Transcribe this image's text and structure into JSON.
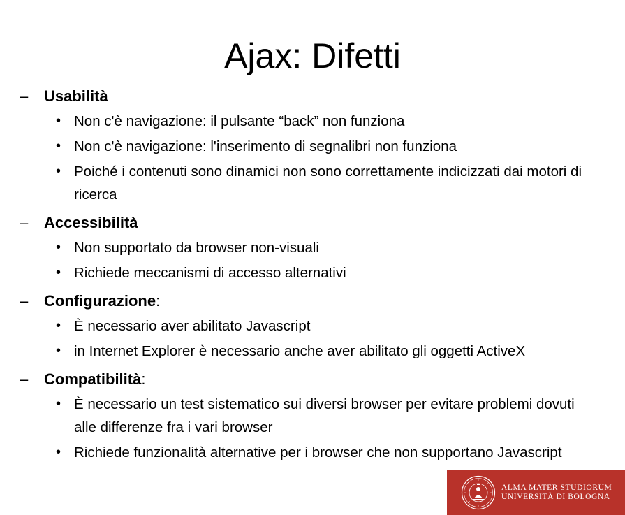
{
  "slide": {
    "title": "Ajax: Difetti"
  },
  "sections": [
    {
      "dash": "–",
      "heading": "Usabilità",
      "suffix": "",
      "items": [
        "Non c'è navigazione: il pulsante “back” non funziona",
        "Non c'è navigazione: l'inserimento di segnalibri non funziona",
        "Poiché i contenuti sono dinamici non sono correttamente indicizzati dai motori di ricerca"
      ]
    },
    {
      "dash": "–",
      "heading": "Accessibilità",
      "suffix": "",
      "items": [
        "Non supportato da browser non-visuali",
        "Richiede meccanismi di accesso alternativi"
      ]
    },
    {
      "dash": "–",
      "heading": "Configurazione",
      "suffix": ":",
      "items": [
        "È necessario aver abilitato Javascript",
        "in Internet Explorer è necessario anche aver abilitato gli oggetti ActiveX"
      ]
    },
    {
      "dash": "–",
      "heading": "Compatibilità",
      "suffix": ":",
      "items": [
        "È necessario un test sistematico sui diversi browser per evitare problemi dovuti alle differenze fra i vari browser",
        "Richiede funzionalità alternative per i browser che non supportano Javascript"
      ]
    }
  ],
  "bullet_glyph": "•",
  "logo": {
    "line1": "ALMA MATER STUDIORUM",
    "line2": "UNIVERSITÀ DI BOLOGNA",
    "icon": "university-seal-icon",
    "background_color": "#b8322a",
    "text_color": "#ffffff"
  }
}
